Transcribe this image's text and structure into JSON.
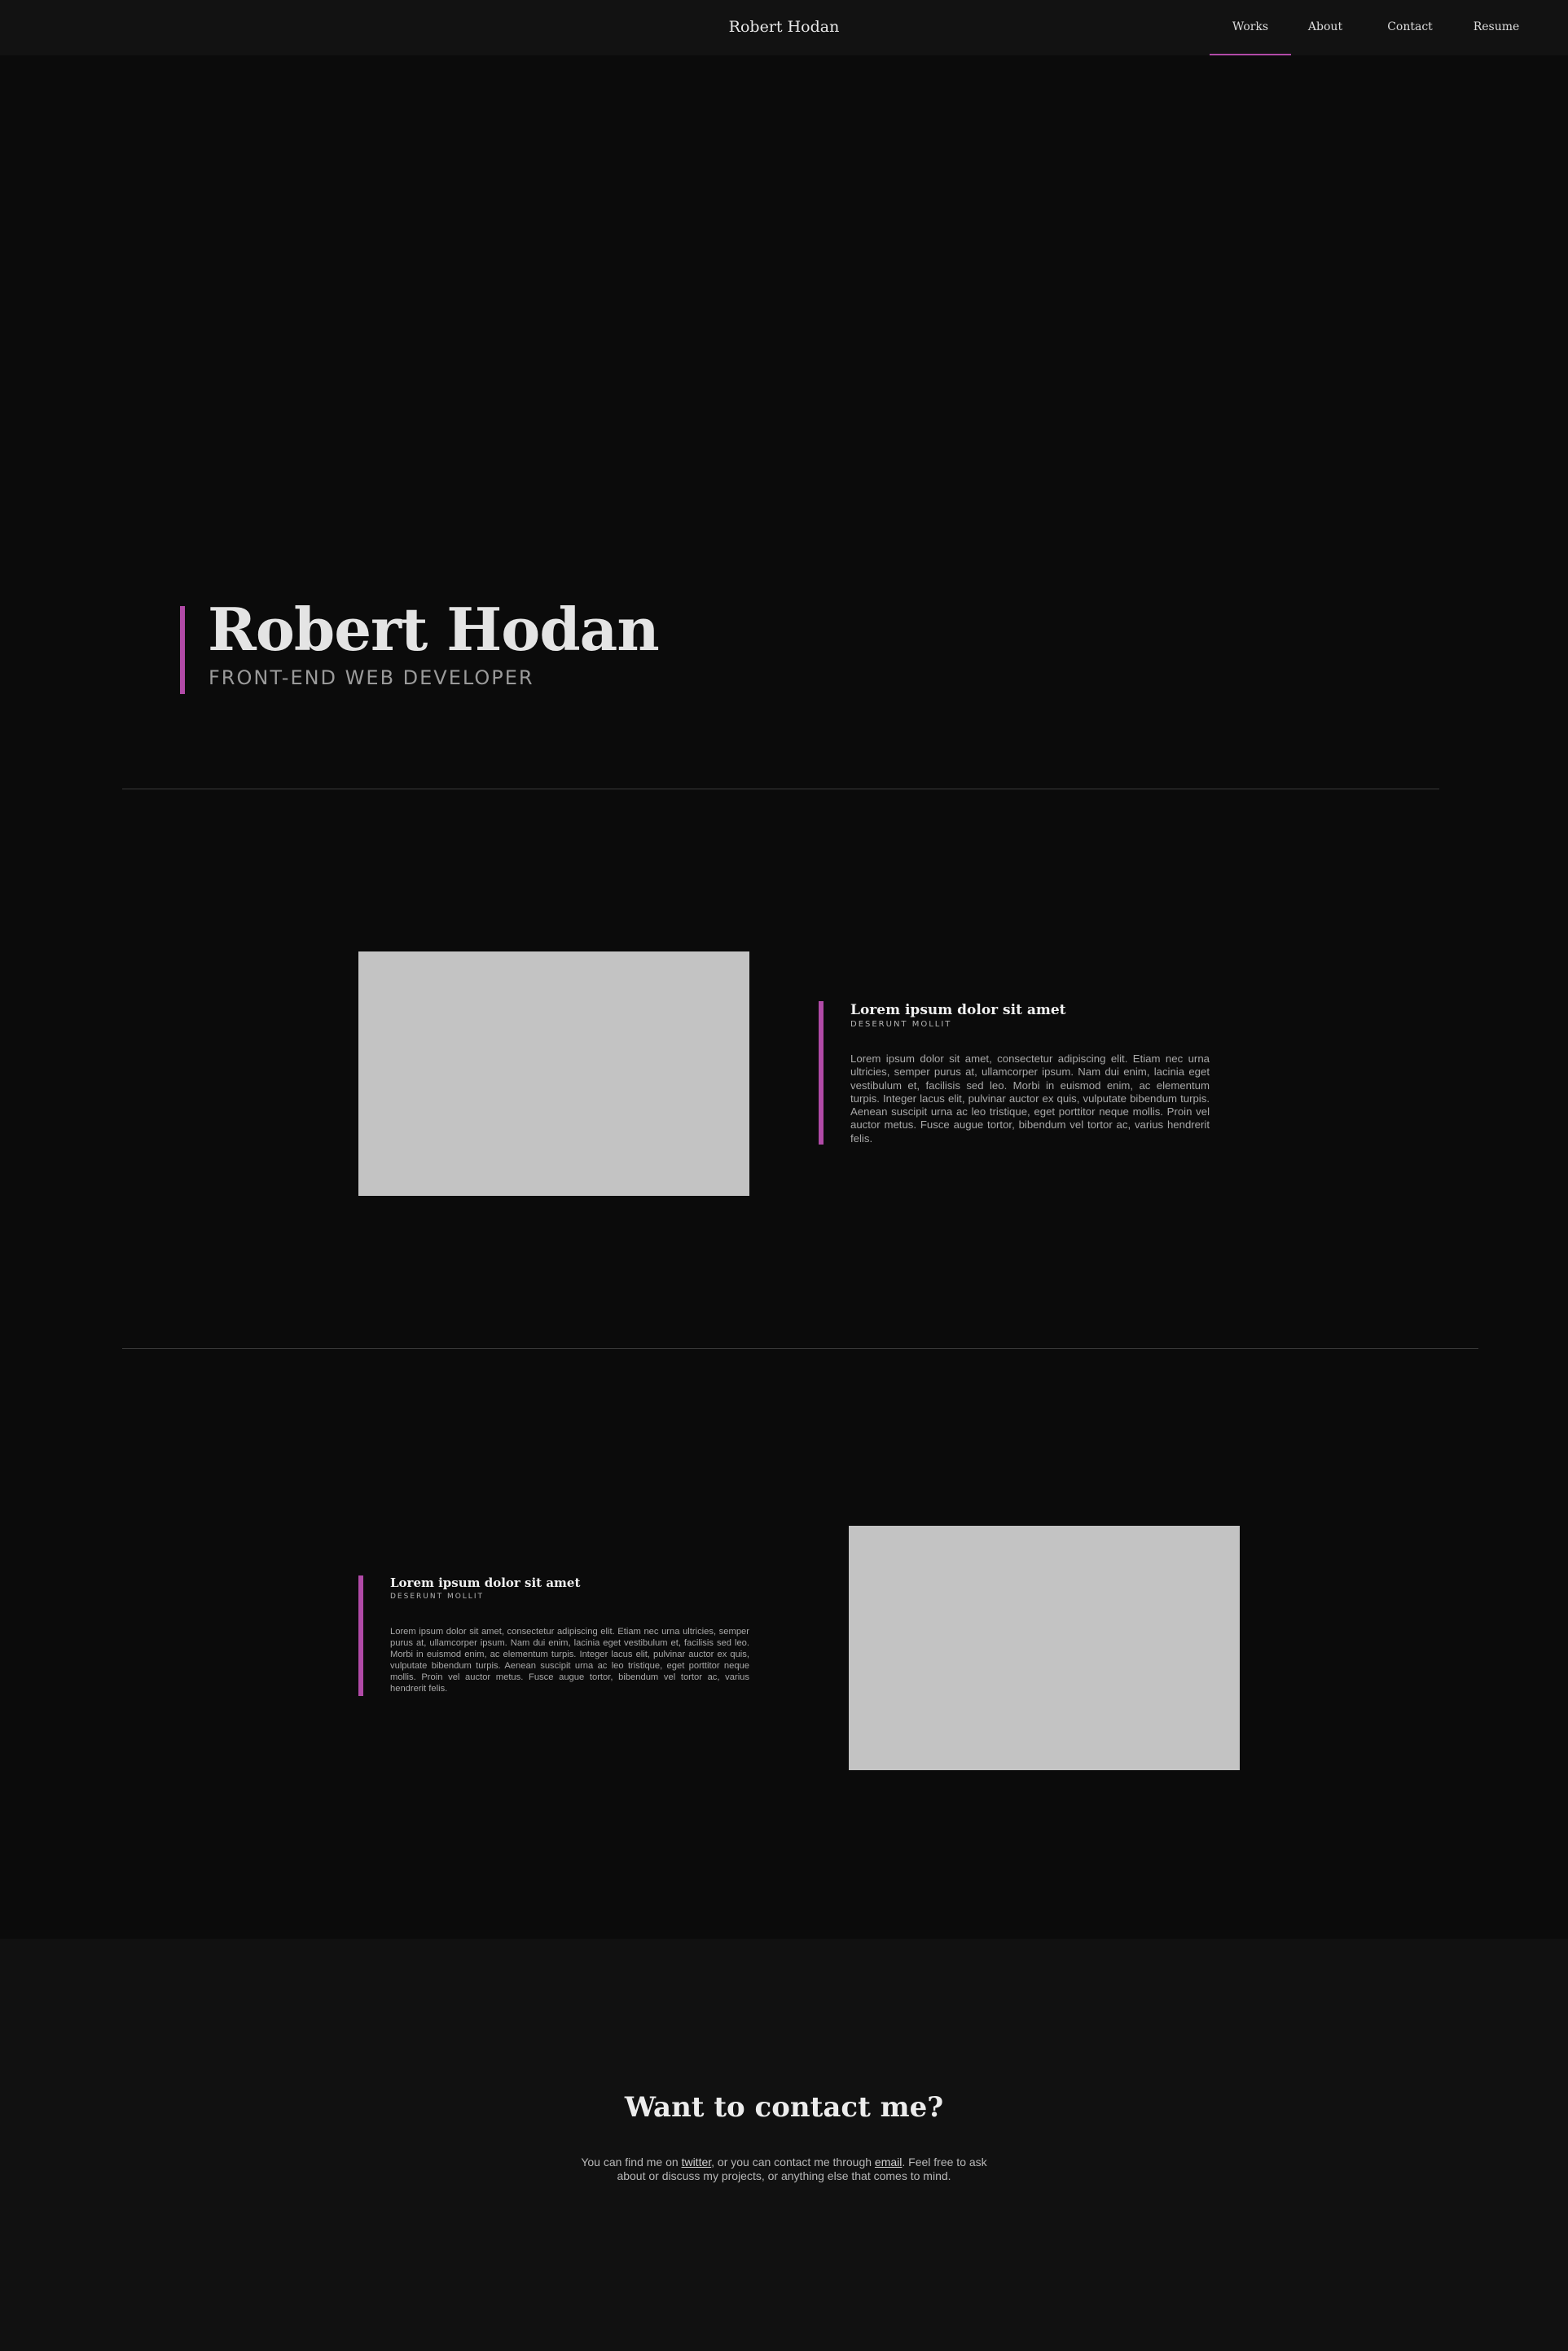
{
  "header": {
    "brand": "Robert Hodan",
    "nav": [
      {
        "label": "Works",
        "active": true
      },
      {
        "label": "About",
        "active": false
      },
      {
        "label": "Contact",
        "active": false
      },
      {
        "label": "Resume",
        "active": false
      }
    ]
  },
  "hero": {
    "title": "Robert Hodan",
    "subtitle": "FRONT-END WEB DEVELOPER"
  },
  "projects": [
    {
      "title": "Lorem ipsum dolor sit amet",
      "subtitle": "DESERUNT MOLLIT",
      "description": "Lorem ipsum dolor sit amet, consectetur adipiscing elit. Etiam nec urna ultricies, semper purus at, ullamcorper ipsum. Nam dui enim, lacinia eget vestibulum et, facilisis sed leo. Morbi in euismod enim, ac elementum turpis. Integer lacus elit, pulvinar auctor ex quis, vulputate bibendum turpis. Aenean suscipit urna ac leo tristique, eget porttitor neque mollis. Proin vel auctor metus. Fusce augue tortor, bibendum vel tortor ac, varius hendrerit felis."
    },
    {
      "title": "Lorem ipsum dolor sit amet",
      "subtitle": "DESERUNT MOLLIT",
      "description": "Lorem ipsum dolor sit amet, consectetur adipiscing elit. Etiam nec urna ultricies, semper purus at, ullamcorper ipsum. Nam dui enim, lacinia eget vestibulum et, facilisis sed leo. Morbi in euismod enim, ac elementum turpis. Integer lacus elit, pulvinar auctor ex quis, vulputate bibendum turpis. Aenean suscipit urna ac leo tristique, eget porttitor neque mollis. Proin vel auctor metus. Fusce augue tortor, bibendum vel tortor ac, varius hendrerit felis."
    }
  ],
  "contact": {
    "title": "Want to contact me?",
    "text_before": "You can find me on ",
    "twitter_link": "twitter",
    "text_middle": ", or you can contact me through ",
    "email_link": "email",
    "text_after": ". Feel free to ask about or discuss my projects, or anything else that comes to mind."
  },
  "colors": {
    "background": "#0b0b0b",
    "header": "#121212",
    "footer": "#111111",
    "accent": "#b14aa7",
    "thumbnail": "#c3c3c3"
  }
}
